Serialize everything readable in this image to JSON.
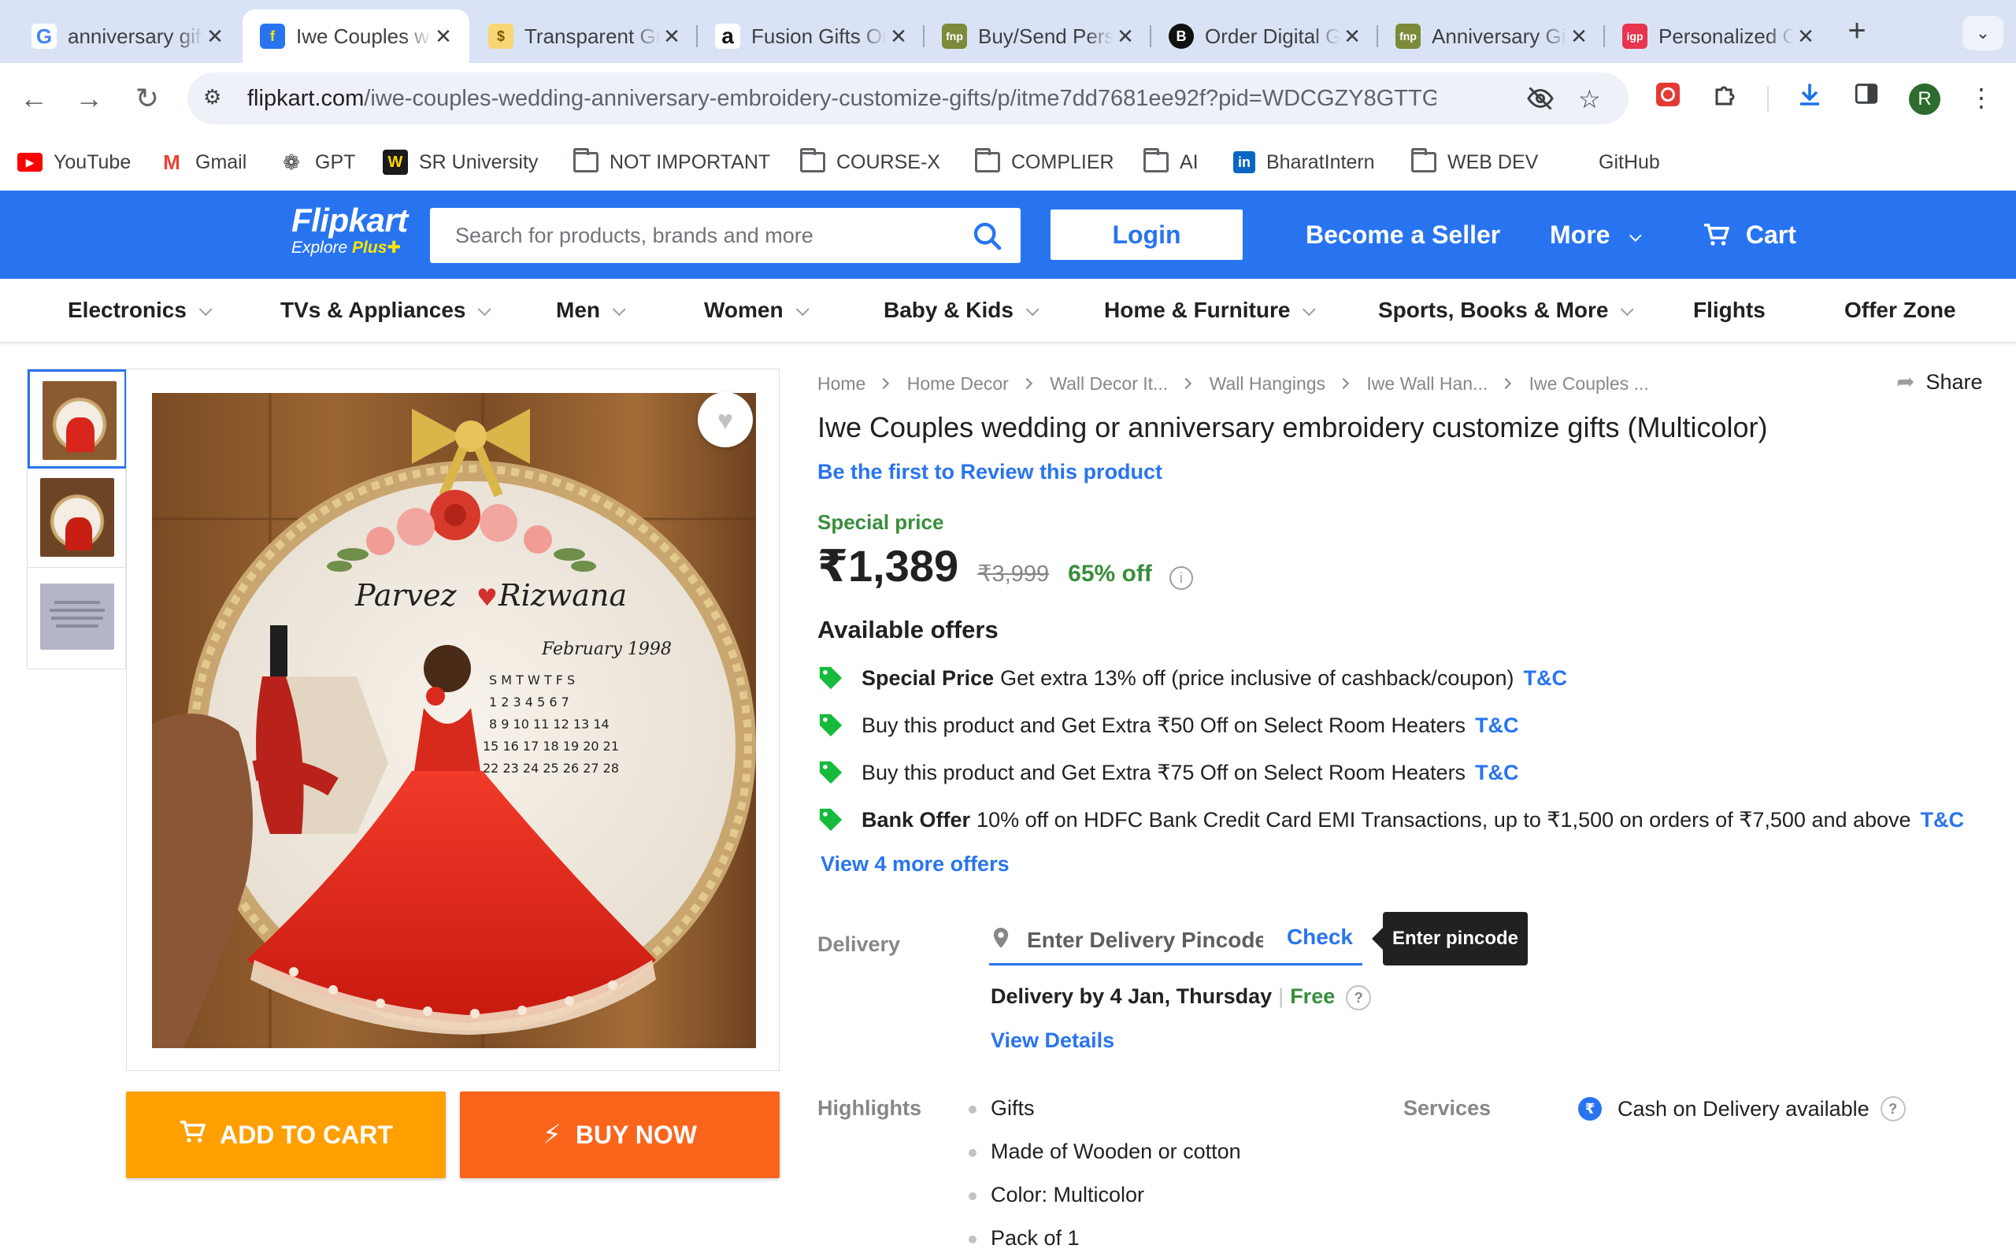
{
  "browser": {
    "tabs": [
      {
        "title": "anniversary gift",
        "favicon": "G"
      },
      {
        "title": "Iwe Couples wedding",
        "favicon": "F"
      },
      {
        "title": "Transparent Gifts",
        "favicon": "$"
      },
      {
        "title": "Fusion Gifts Online",
        "favicon": "a"
      },
      {
        "title": "Buy/Send Personalised",
        "favicon": "fnp"
      },
      {
        "title": "Order Digital Gifts",
        "favicon": "B"
      },
      {
        "title": "Anniversary Gifts",
        "favicon": "fnp"
      },
      {
        "title": "Personalized Gifts",
        "favicon": "igp"
      }
    ],
    "url_host": "flipkart.com",
    "url_path": "/iwe-couples-wedding-anniversary-embroidery-customize-gifts/p/itme7dd7681ee92f?pid=WDCGZY8GTTG...",
    "profile_initial": "R",
    "bookmarks": [
      {
        "label": "YouTube",
        "icon": "youtube-icon"
      },
      {
        "label": "Gmail",
        "icon": "gmail-icon"
      },
      {
        "label": "GPT",
        "icon": "chatgpt-icon"
      },
      {
        "label": "SR University",
        "icon": "sr-university-icon"
      },
      {
        "label": "NOT IMPORTANT",
        "icon": "folder-icon"
      },
      {
        "label": "COURSE-X",
        "icon": "folder-icon"
      },
      {
        "label": "COMPLIER",
        "icon": "folder-icon"
      },
      {
        "label": "AI",
        "icon": "folder-icon"
      },
      {
        "label": "BharatIntern",
        "icon": "linkedin-icon"
      },
      {
        "label": "WEB DEV",
        "icon": "folder-icon"
      },
      {
        "label": "GitHub",
        "icon": ""
      }
    ]
  },
  "header": {
    "logo": "Flipkart",
    "logo_sub_prefix": "Explore",
    "logo_sub_plus": "Plus",
    "search_placeholder": "Search for products, brands and more",
    "login": "Login",
    "seller": "Become a Seller",
    "more": "More",
    "cart": "Cart",
    "brand_color": "#2874f0"
  },
  "categories": [
    "Electronics",
    "TVs & Appliances",
    "Men",
    "Women",
    "Baby & Kids",
    "Home & Furniture",
    "Sports, Books & More",
    "Flights",
    "Offer Zone"
  ],
  "product": {
    "breadcrumbs": [
      "Home",
      "Home Decor",
      "Wall Decor It...",
      "Wall Hangings",
      "Iwe Wall Han...",
      "Iwe Couples ..."
    ],
    "share": "Share",
    "title": "Iwe Couples wedding or anniversary embroidery customize gifts  (Multicolor)",
    "review_link": "Be the first to Review this product",
    "special_price_label": "Special price",
    "price": "₹1,389",
    "mrp": "₹3,999",
    "discount": "65% off",
    "image_text": {
      "names": "Parvez ♥ Rizwana",
      "month": "February 1998"
    },
    "add_to_cart": "ADD TO CART",
    "buy_now": "BUY NOW"
  },
  "offers": {
    "heading": "Available offers",
    "items": [
      {
        "bold": "Special Price",
        "text": "Get extra 13% off (price inclusive of cashback/coupon)",
        "link": "T&C"
      },
      {
        "bold": "",
        "text": "Buy this product and Get Extra ₹50 Off on Select Room Heaters",
        "link": "T&C"
      },
      {
        "bold": "",
        "text": "Buy this product and Get Extra ₹75 Off on Select Room Heaters",
        "link": "T&C"
      },
      {
        "bold": "Bank Offer",
        "text": "10% off on HDFC Bank Credit Card EMI Transactions, up to ₹1,500 on orders of ₹7,500 and above",
        "link": "T&C"
      }
    ],
    "more": "View 4 more offers"
  },
  "delivery": {
    "label": "Delivery",
    "pincode_placeholder": "Enter Delivery Pincode",
    "check": "Check",
    "tooltip": "Enter pincode",
    "date": "Delivery by 4 Jan, Thursday",
    "sep": "|",
    "free": "Free",
    "view_details": "View Details"
  },
  "highlights": {
    "label": "Highlights",
    "items": [
      "Gifts",
      "Made of Wooden or cotton",
      "Color: Multicolor",
      "Pack of 1"
    ]
  },
  "services": {
    "label": "Services",
    "items": [
      "Cash on Delivery available"
    ]
  }
}
